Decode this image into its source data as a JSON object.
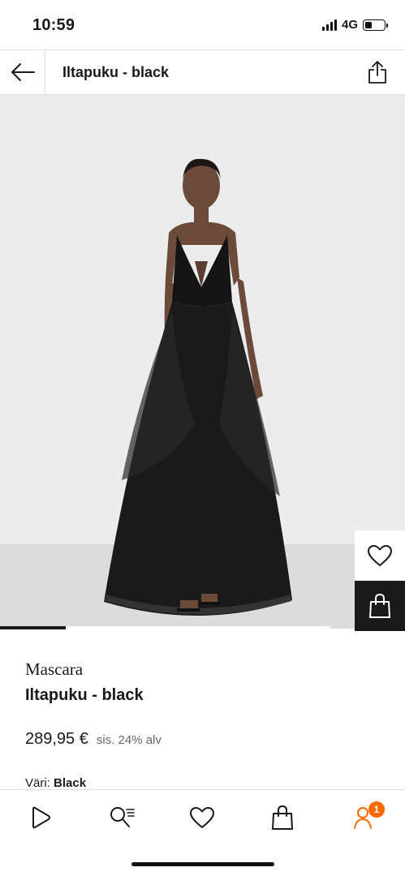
{
  "status": {
    "time": "10:59",
    "network": "4G",
    "battery_level": 0.35
  },
  "header": {
    "title": "Iltapuku - black"
  },
  "icons": {
    "back": "arrow-left-icon",
    "share": "share-icon",
    "wishlist": "heart-icon",
    "add_to_bag": "bag-icon"
  },
  "gallery": {
    "progress": 0.2
  },
  "product": {
    "brand": "Mascara",
    "name": "Iltapuku - black",
    "price": "289,95 €",
    "vat_note": "sis. 24% alv",
    "color_label": "Väri:",
    "color_value": "Black"
  },
  "bottom_nav": {
    "items": [
      {
        "name": "discover",
        "icon": "play-icon"
      },
      {
        "name": "search",
        "icon": "search-list-icon"
      },
      {
        "name": "wishlist",
        "icon": "heart-icon"
      },
      {
        "name": "bag",
        "icon": "bag-icon"
      },
      {
        "name": "account",
        "icon": "profile-icon",
        "badge": "1"
      }
    ]
  },
  "colors": {
    "accent": "#ff6900",
    "dark": "#1a1a1a"
  }
}
